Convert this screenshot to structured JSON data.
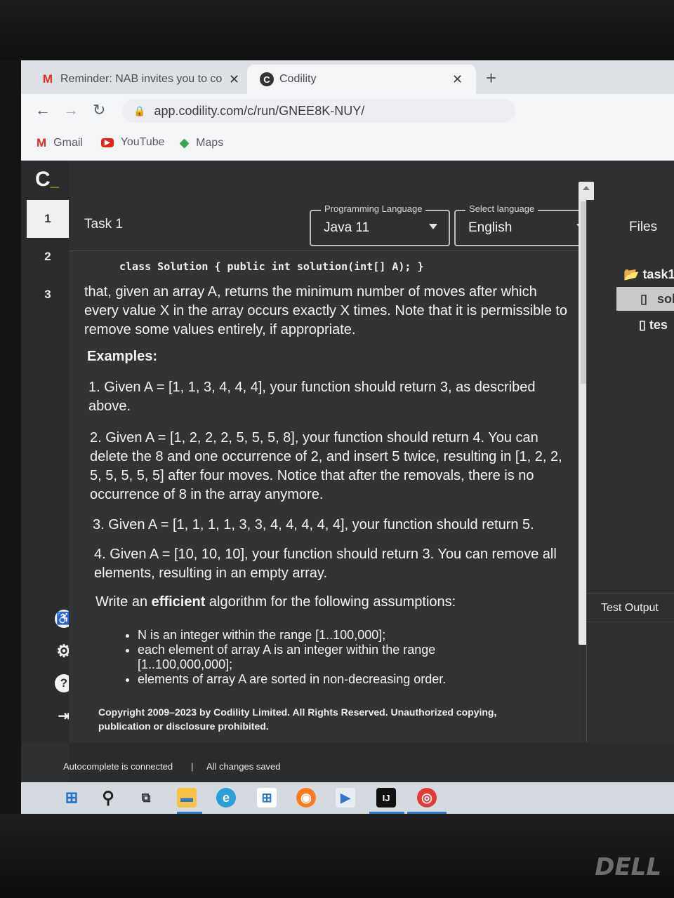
{
  "browser": {
    "tabs": [
      {
        "title": "Reminder: NAB invites you to co",
        "icon": "gmail-icon",
        "active": false
      },
      {
        "title": "Codility",
        "icon": "codility-icon",
        "active": true
      }
    ],
    "url": "app.codility.com/c/run/GNEE8K-NUY/",
    "bookmarks": [
      {
        "label": "Gmail",
        "icon": "gmail-icon"
      },
      {
        "label": "YouTube",
        "icon": "youtube-icon"
      },
      {
        "label": "Maps",
        "icon": "maps-icon"
      }
    ]
  },
  "app": {
    "brand": "C",
    "tasks": [
      "1",
      "2",
      "3"
    ],
    "task_title": "Task 1",
    "programming_language": {
      "label": "Programming Language",
      "value": "Java 11"
    },
    "ui_language": {
      "label": "Select language",
      "value": "English"
    },
    "files": {
      "title": "Files",
      "items": [
        "task1",
        "sol",
        "tes"
      ]
    },
    "test_output_label": "Test Output",
    "status": {
      "autocomplete": "Autocomplete is connected",
      "separator": "|",
      "saved": "All changes saved"
    }
  },
  "problem": {
    "signature": "class Solution { public int solution(int[] A); }",
    "intro": "that, given an array A, returns the minimum number of moves after which every value X in the array occurs exactly X times. Note that it is permissible to remove some values entirely, if appropriate.",
    "examples_heading": "Examples:",
    "examples": [
      "1. Given A = [1, 1, 3, 4, 4, 4], your function should return 3, as described above.",
      "2. Given A = [1, 2, 2, 2, 5, 5, 5, 8], your function should return 4. You can delete the 8 and one occurrence of 2, and insert 5 twice, resulting in [1, 2, 2, 5, 5, 5, 5, 5] after four moves. Notice that after the removals, there is no occurrence of 8 in the array anymore.",
      "3. Given A = [1, 1, 1, 1, 3, 3, 4, 4, 4, 4, 4], your function should return 5.",
      "4. Given A = [10, 10, 10], your function should return 3. You can remove all elements, resulting in an empty array."
    ],
    "assumptions_pre": "Write an ",
    "assumptions_bold": "efficient",
    "assumptions_post": " algorithm for the following assumptions:",
    "assumptions": [
      "N is an integer within the range [1..100,000];",
      "each element of array A is an integer within the range [1..100,000,000];",
      "elements of array A are sorted in non-decreasing order."
    ],
    "copyright": "Copyright 2009–2023 by Codility Limited. All Rights Reserved. Unauthorized copying, publication or disclosure prohibited."
  },
  "bezel": {
    "logo": "DELL"
  }
}
